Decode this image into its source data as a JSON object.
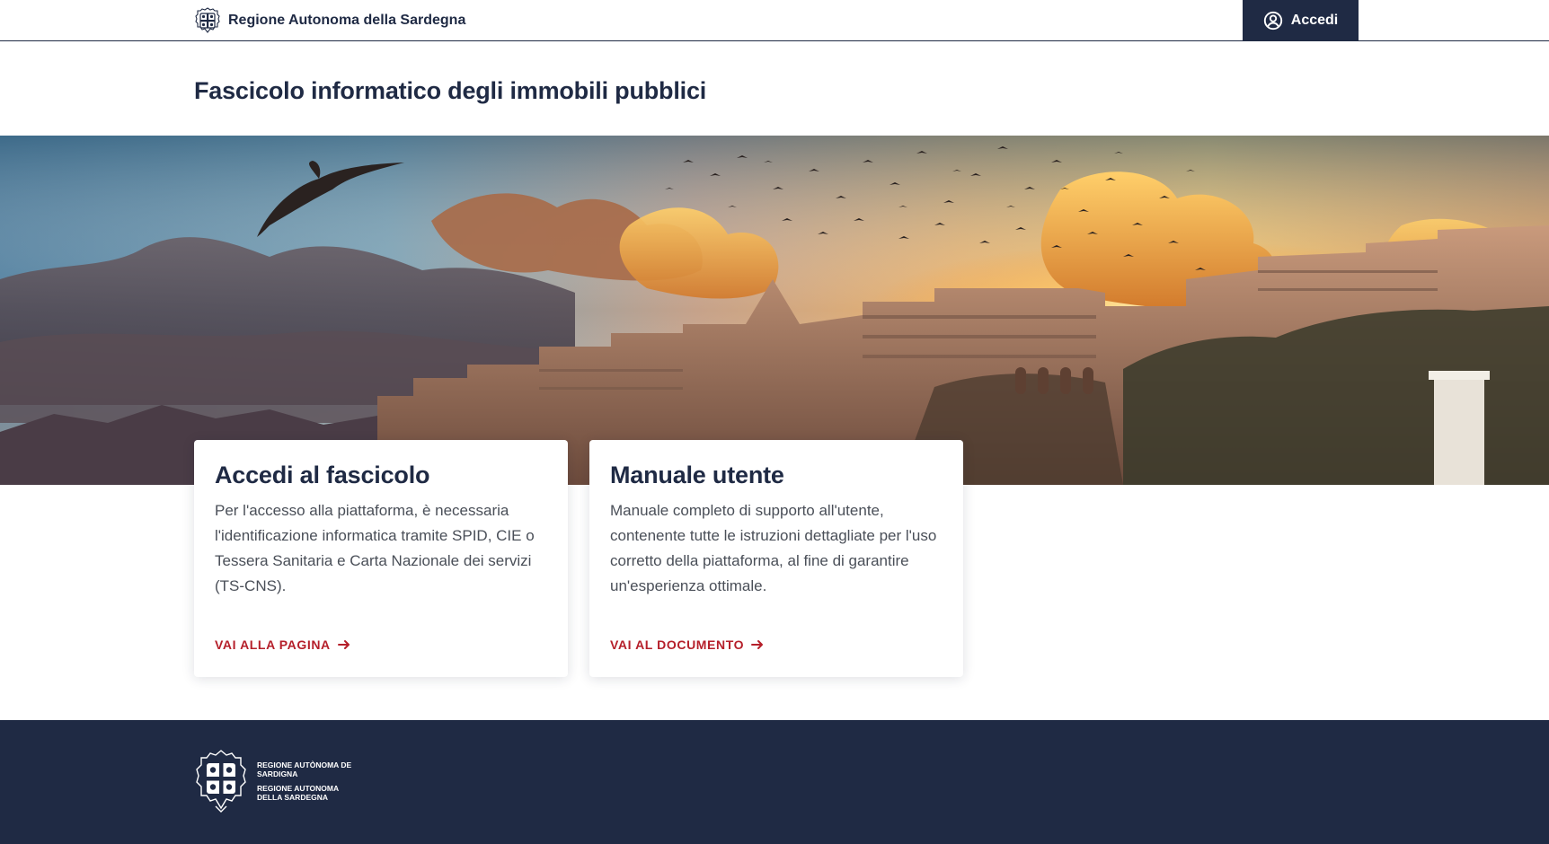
{
  "header": {
    "brand_name": "Regione Autonoma della Sardegna",
    "emblem_icon": "sardinia-coat-of-arms-icon",
    "login_label": "Accedi",
    "login_icon": "user-circle-icon"
  },
  "page": {
    "title": "Fascicolo informatico degli immobili pubblici"
  },
  "hero": {
    "image": "Cagliari skyline at sunset with seagull and flock of birds"
  },
  "cards": [
    {
      "title": "Accedi al fascicolo",
      "text": "Per l'accesso alla piattaforma, è necessaria l'identificazione informatica tramite SPID, CIE o Tessera Sanitaria e Carta Nazionale dei servizi (TS-CNS).",
      "link_label": "VAI ALLA PAGINA",
      "link_icon": "arrow-right-icon"
    },
    {
      "title": "Manuale utente",
      "text": "Manuale completo di supporto all'utente, contenente tutte le istruzioni dettagliate per l'uso corretto della piattaforma, al fine di garantire un'esperienza ottimale.",
      "link_label": "VAI AL DOCUMENTO",
      "link_icon": "arrow-right-icon"
    }
  ],
  "footer": {
    "logo_line_1": "REGIONE AUTÒNOMA DE SARDIGNA",
    "logo_line_2": "REGIONE AUTONOMA DELLA SARDEGNA",
    "emblem_icon": "sardinia-coat-of-arms-icon"
  },
  "colors": {
    "navy": "#1f2a44",
    "link_red": "#b51f2a",
    "body_text": "#4a4f58"
  }
}
